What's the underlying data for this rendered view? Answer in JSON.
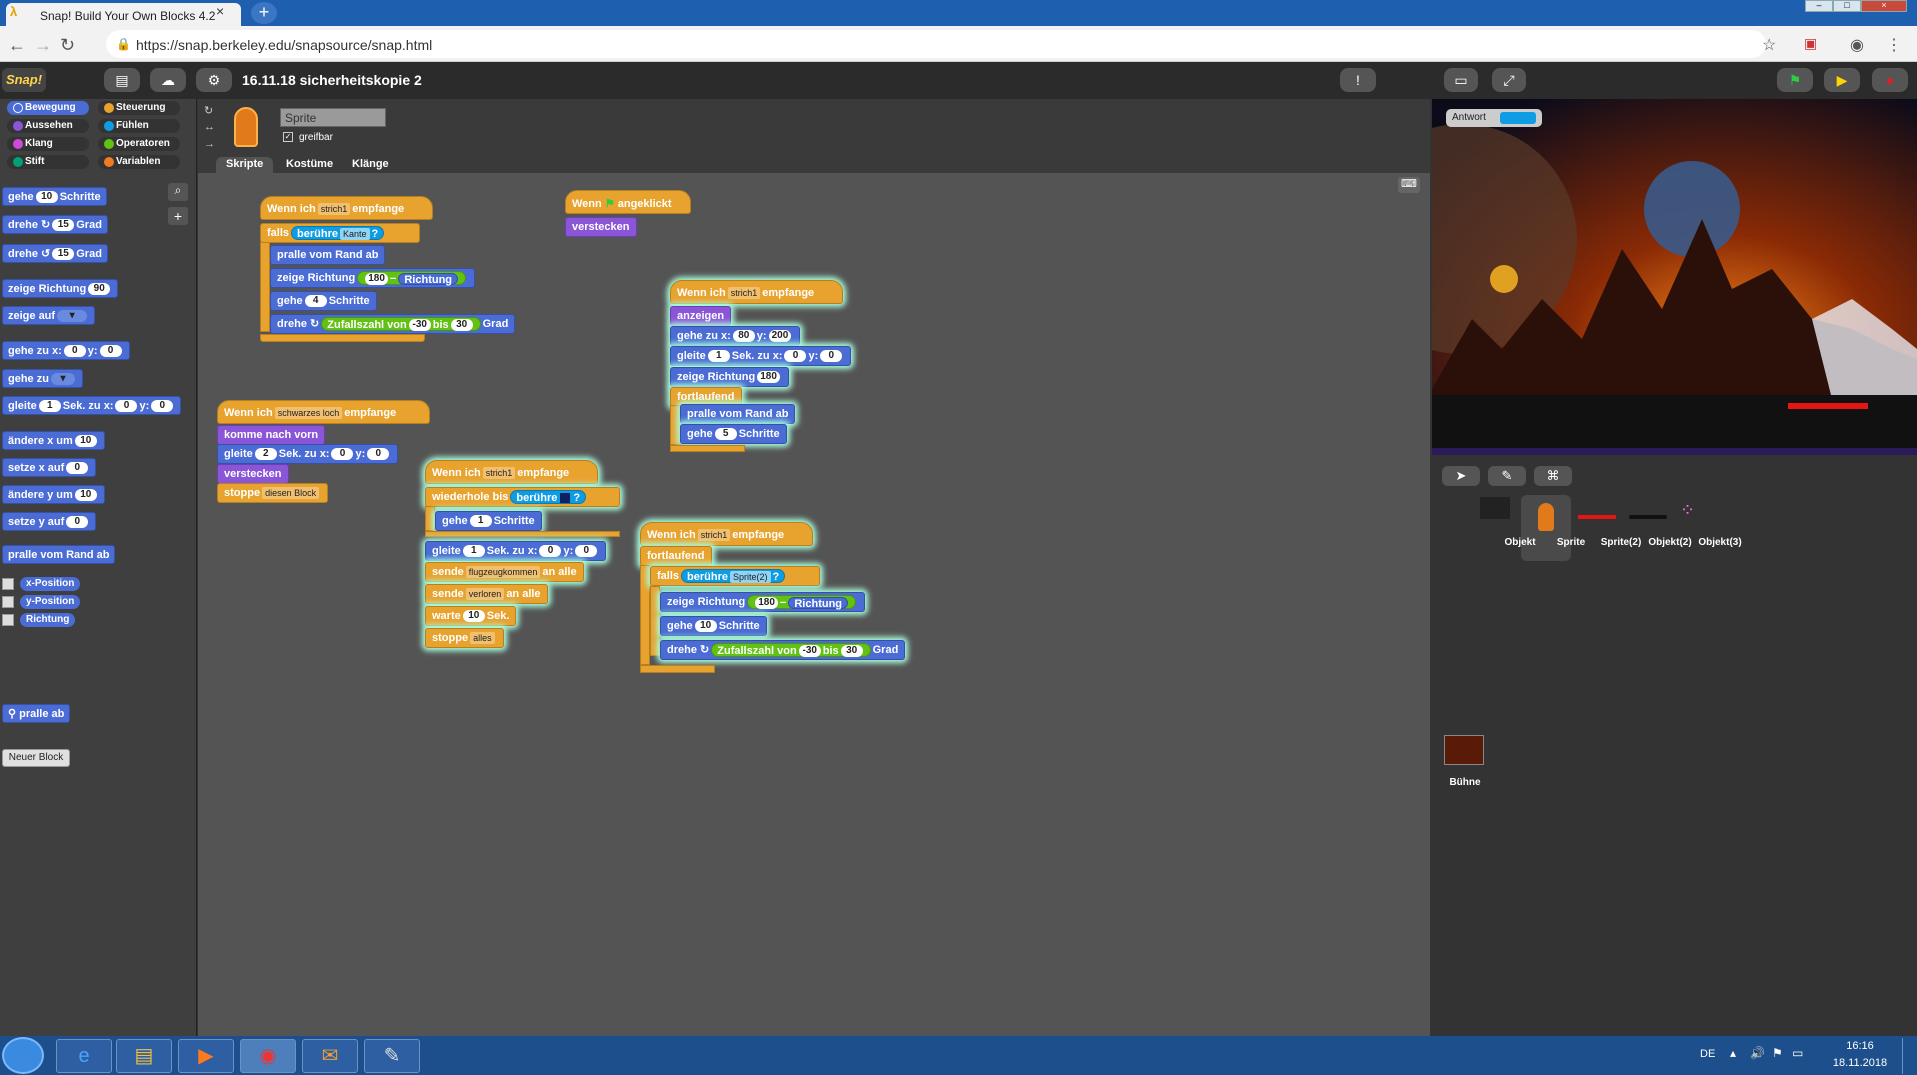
{
  "browser": {
    "tab_title": "Snap! Build Your Own Blocks 4.2",
    "close_glyph": "×",
    "new_tab_glyph": "+",
    "url": "https://snap.berkeley.edu/snapsource/snap.html"
  },
  "snap": {
    "logo": "Snap!",
    "project_title": "16.11.18 sicherheitskopie 2",
    "categories": [
      "Bewegung",
      "Aussehen",
      "Klang",
      "Stift",
      "Steuerung",
      "Fühlen",
      "Operatoren",
      "Variablen"
    ],
    "palette": {
      "gehe": "gehe",
      "gehe_val": "10",
      "schritte": "Schritte",
      "drehe": "drehe",
      "drehe_val1": "15",
      "grad": "Grad",
      "drehe_val2": "15",
      "zeige_richtung": "zeige Richtung",
      "richtung_val": "90",
      "zeige_auf": "zeige auf",
      "gehe_zu_x": "gehe zu x:",
      "x0": "0",
      "y_label": "y:",
      "y0": "0",
      "gehe_zu": "gehe zu",
      "gleite": "gleite",
      "gleite_val": "1",
      "sek_zu_x": "Sek. zu x:",
      "aendere_x": "ändere x um",
      "aendere_x_val": "10",
      "setze_x": "setze x auf",
      "setze_x_val": "0",
      "aendere_y": "ändere y um",
      "aendere_y_val": "10",
      "setze_y": "setze y auf",
      "setze_y_val": "0",
      "pralle": "pralle vom Rand ab",
      "rep_x": "x-Position",
      "rep_y": "y-Position",
      "rep_dir": "Richtung",
      "neuer_block": "Neuer Block",
      "custom": "pralle ab"
    },
    "sprite_name": "Sprite",
    "greifbar": "greifbar",
    "tabs": [
      "Skripte",
      "Kostüme",
      "Klänge"
    ],
    "scripts": {
      "s1": {
        "hat_a": "Wenn ich",
        "hat_msg": "strich1",
        "hat_b": "empfange",
        "falls": "falls",
        "beruehre": "berühre",
        "kante": "Kante",
        "q": "?",
        "pralle": "pralle vom Rand ab",
        "zeige": "zeige Richtung",
        "n180": "180",
        "minus": "−",
        "richtung": "Richtung",
        "gehe": "gehe",
        "n4": "4",
        "schritte": "Schritte",
        "drehe": "drehe",
        "zufall": "Zufallszahl von",
        "n_30": "-30",
        "bis": "bis",
        "n30": "30",
        "grad": "Grad"
      },
      "s2": {
        "hat_a": "Wenn",
        "hat_b": "angeklickt",
        "verstecken": "verstecken"
      },
      "s3": {
        "hat_a": "Wenn ich",
        "hat_msg": "strich1",
        "hat_b": "empfange",
        "anzeigen": "anzeigen",
        "gehe_zu_x": "gehe zu x:",
        "x": "80",
        "y_label": "y:",
        "y": "200",
        "gleite": "gleite",
        "n1": "1",
        "sek_zu_x": "Sek. zu x:",
        "gx": "0",
        "gy": "0",
        "zeige": "zeige Richtung",
        "dir": "180",
        "fortlaufend": "fortlaufend",
        "pralle": "pralle vom Rand ab",
        "gehe": "gehe",
        "n5": "5",
        "schritte": "Schritte"
      },
      "s4": {
        "hat_a": "Wenn ich",
        "hat_msg": "schwarzes loch",
        "hat_b": "empfange",
        "komme": "komme nach vorn",
        "gleite": "gleite",
        "n2": "2",
        "sek_zu_x": "Sek. zu x:",
        "gx": "0",
        "y_label": "y:",
        "gy": "0",
        "verstecken": "verstecken",
        "stoppe": "stoppe",
        "dieser": "diesen Block"
      },
      "s5": {
        "hat_a": "Wenn ich",
        "hat_msg": "strich1",
        "hat_b": "empfange",
        "wiederhole": "wiederhole bis",
        "beruehre": "berühre",
        "q": "?",
        "gehe": "gehe",
        "n1": "1",
        "schritte": "Schritte",
        "gleite": "gleite",
        "g1": "1",
        "sek_zu_x": "Sek. zu x:",
        "gx": "0",
        "y_label": "y:",
        "gy": "0",
        "sende": "sende",
        "flug": "flugzeugkommen",
        "an_alle": "an alle",
        "verloren": "verloren",
        "warte": "warte",
        "n10": "10",
        "sek": "Sek.",
        "stoppe": "stoppe",
        "alles": "alles"
      },
      "s6": {
        "hat_a": "Wenn ich",
        "hat_msg": "strich1",
        "hat_b": "empfange",
        "fortlaufend": "fortlaufend",
        "falls": "falls",
        "beruehre": "berühre",
        "sprite2": "Sprite(2)",
        "q": "?",
        "zeige": "zeige Richtung",
        "n180": "180",
        "minus": "−",
        "richtung": "Richtung",
        "gehe": "gehe",
        "n10": "10",
        "schritte": "Schritte",
        "drehe": "drehe",
        "zufall": "Zufallszahl von",
        "n_30": "-30",
        "bis": "bis",
        "n30": "30",
        "grad": "Grad"
      }
    },
    "stage": {
      "watcher_label": "Antwort"
    },
    "sprites": [
      "Objekt",
      "Sprite",
      "Sprite(2)",
      "Objekt(2)",
      "Objekt(3)"
    ],
    "stage_label": "Bühne"
  },
  "taskbar": {
    "lang": "DE",
    "time": "16:16",
    "date": "18.11.2018"
  },
  "colors": {
    "motion": "#4a6cd4",
    "looks": "#8a55d7",
    "control": "#e8a32f",
    "sensing": "#0e9de3",
    "operators": "#62c213"
  }
}
